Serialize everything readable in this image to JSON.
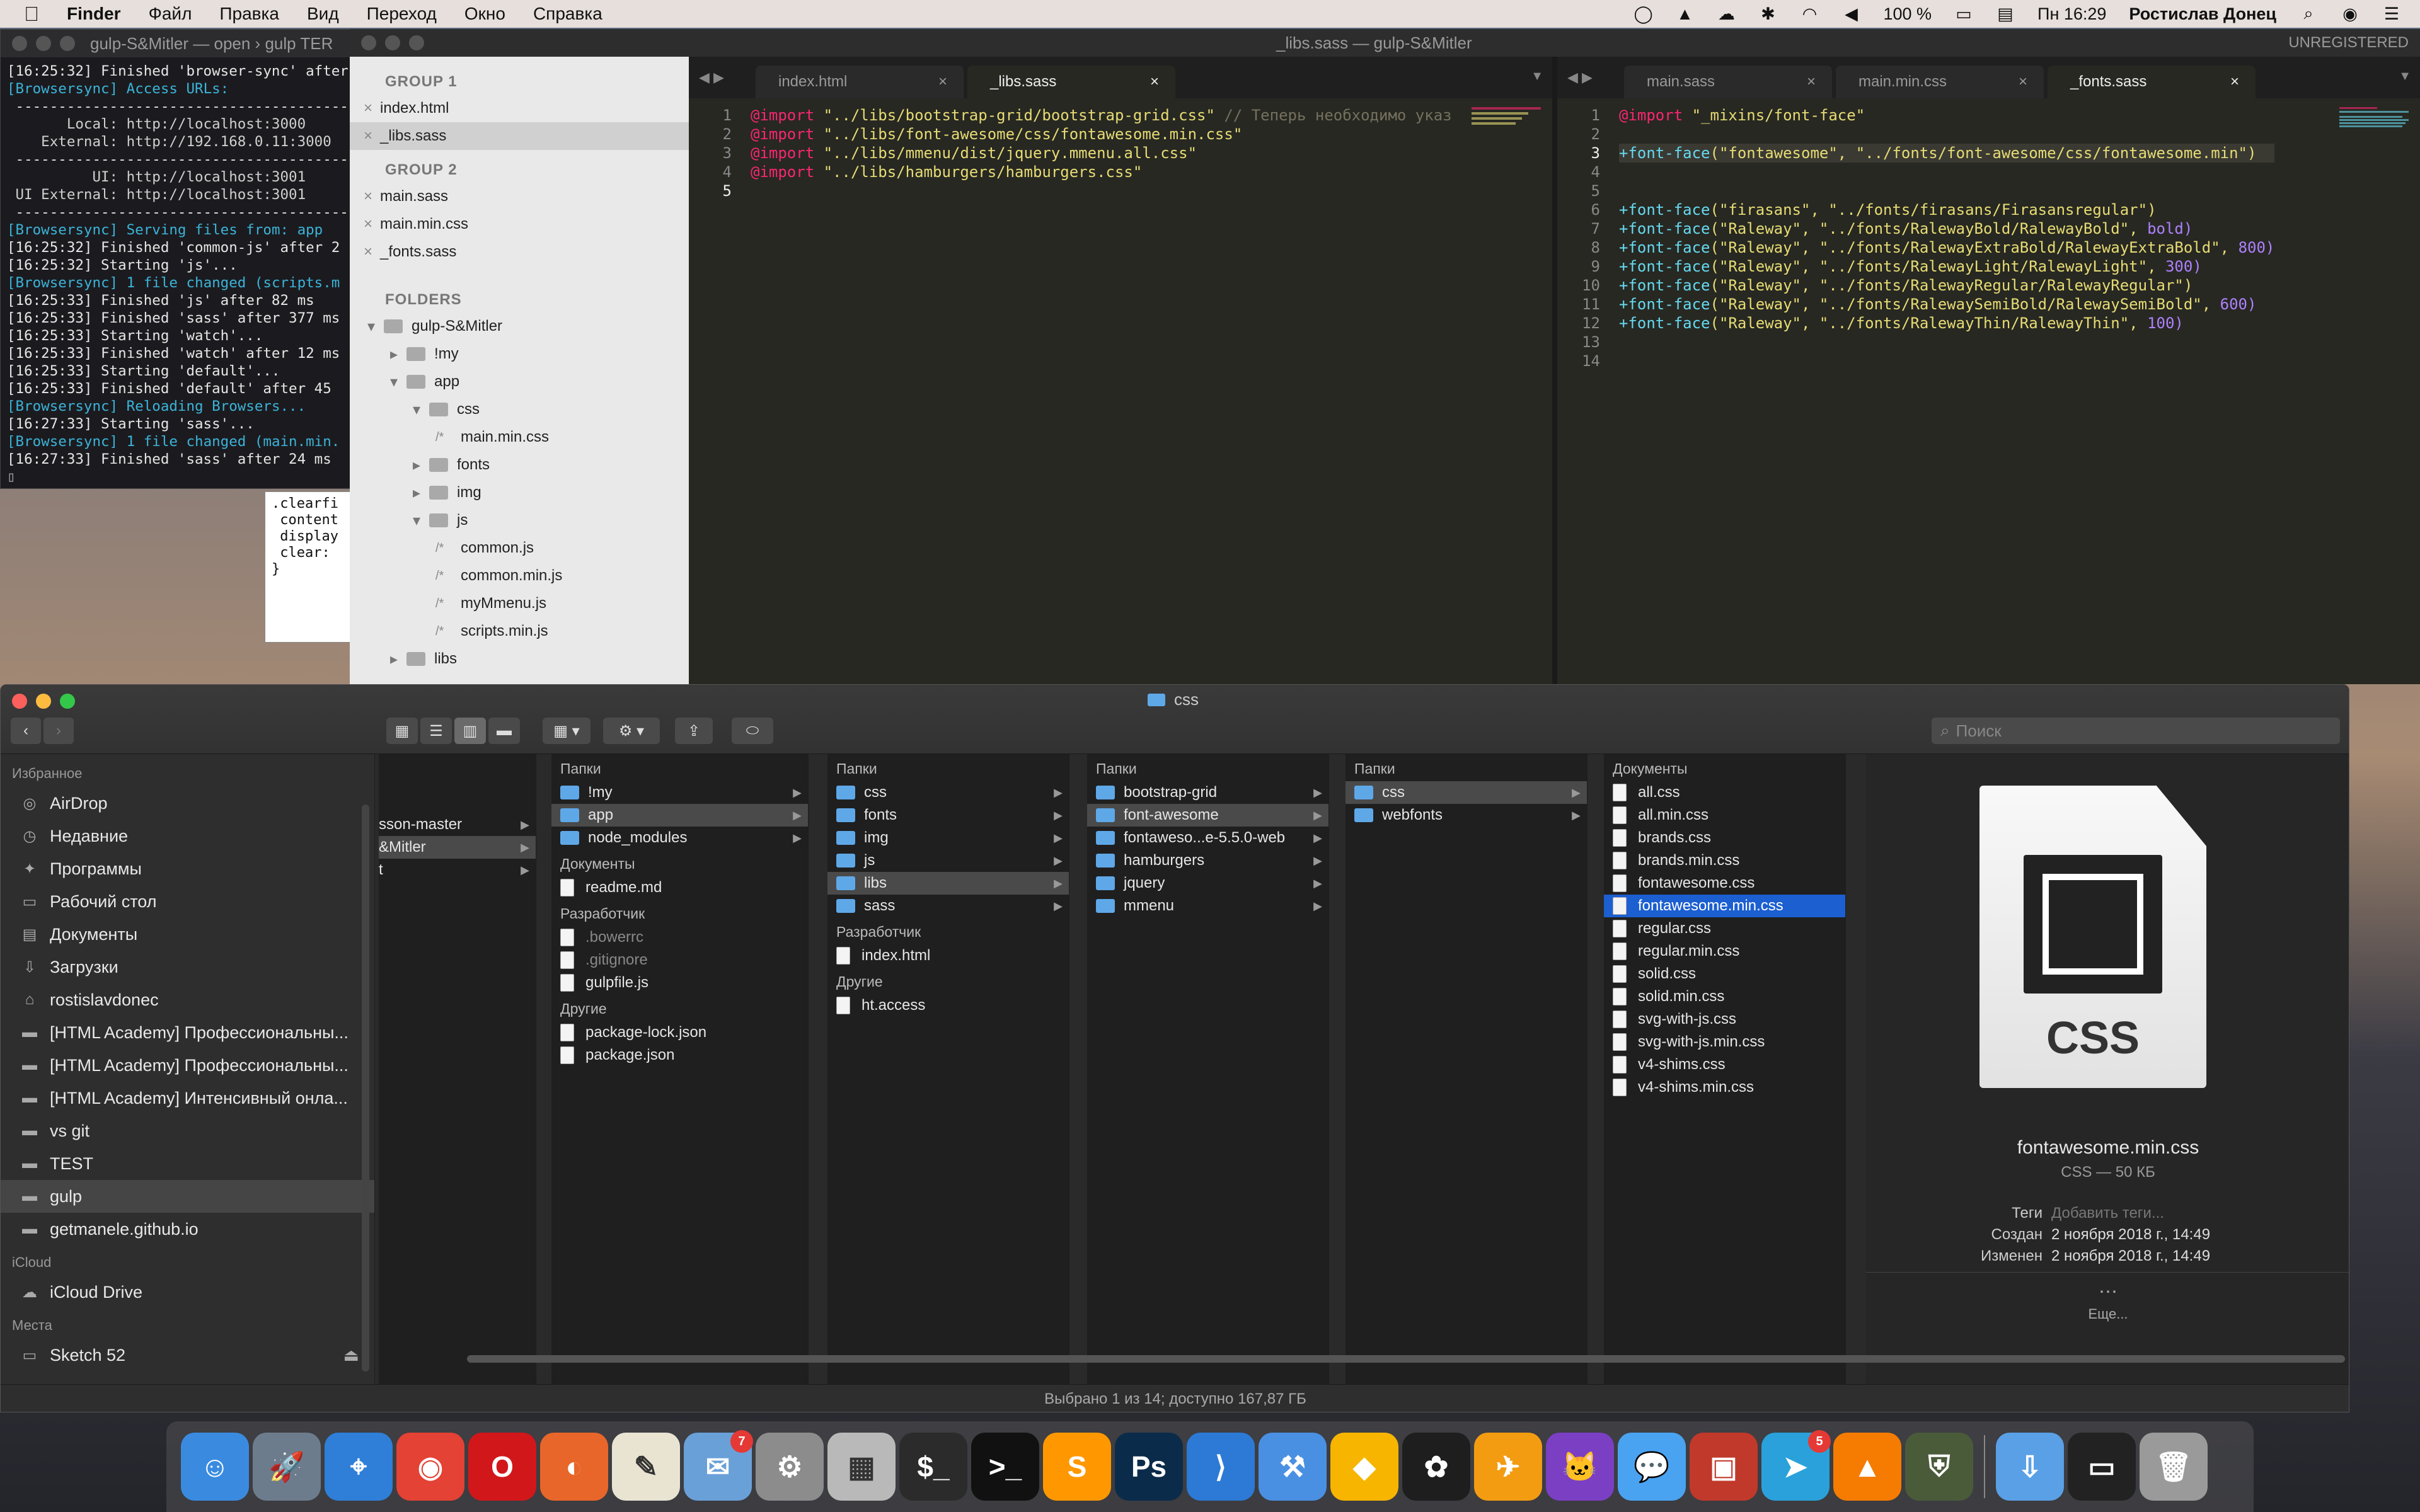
{
  "menubar": {
    "apple_icon": "apple-icon",
    "app_name": "Finder",
    "items": [
      "Файл",
      "Правка",
      "Вид",
      "Переход",
      "Окно",
      "Справка"
    ],
    "battery": "100 %",
    "clock": "Пн 16:29",
    "user": "Ростислав Донец"
  },
  "terminal": {
    "title": "gulp-S&Mitler — open › gulp TER",
    "lines": [
      "[16:25:32] Finished 'browser-sync' after",
      "[Browsersync] Access URLs:",
      " ----------------------------------------",
      "       Local: http://localhost:3000",
      "    External: http://192.168.0.11:3000",
      " ----------------------------------------",
      "          UI: http://localhost:3001",
      " UI External: http://localhost:3001",
      " ----------------------------------------",
      "[Browsersync] Serving files from: app",
      "[16:25:32] Finished 'common-js' after 2",
      "[16:25:32] Starting 'js'...",
      "[Browsersync] 1 file changed (scripts.m",
      "[16:25:33] Finished 'js' after 82 ms",
      "[16:25:33] Finished 'sass' after 377 ms",
      "[16:25:33] Starting 'watch'...",
      "[16:25:33] Finished 'watch' after 12 ms",
      "[16:25:33] Starting 'default'...",
      "[16:25:33] Finished 'default' after 45",
      "[Browsersync] Reloading Browsers...",
      "[16:27:33] Starting 'sass'...",
      "[Browsersync] 1 file changed (main.min.",
      "[16:27:33] Finished 'sass' after 24 ms"
    ]
  },
  "snippet": {
    "lines": [
      ".clearfi",
      " content",
      " display",
      " clear:",
      "}"
    ]
  },
  "sublime": {
    "title": "_libs.sass — gulp-S&Mitler",
    "unregistered": "UNREGISTERED",
    "sidebar": {
      "group1_label": "GROUP 1",
      "group1_files": [
        "index.html",
        "_libs.sass"
      ],
      "group2_label": "GROUP 2",
      "group2_files": [
        "main.sass",
        "main.min.css",
        "_fonts.sass"
      ],
      "folders_label": "FOLDERS",
      "tree": [
        {
          "label": "gulp-S&Mitler",
          "kind": "folder",
          "open": true
        },
        {
          "label": "!my",
          "kind": "folder",
          "open": false
        },
        {
          "label": "app",
          "kind": "folder",
          "open": true
        },
        {
          "label": "css",
          "kind": "folder",
          "open": true
        },
        {
          "label": "main.min.css",
          "kind": "file"
        },
        {
          "label": "fonts",
          "kind": "folder",
          "open": false
        },
        {
          "label": "img",
          "kind": "folder",
          "open": false
        },
        {
          "label": "js",
          "kind": "folder",
          "open": true
        },
        {
          "label": "common.js",
          "kind": "file"
        },
        {
          "label": "common.min.js",
          "kind": "file"
        },
        {
          "label": "myMmenu.js",
          "kind": "file"
        },
        {
          "label": "scripts.min.js",
          "kind": "file"
        },
        {
          "label": "libs",
          "kind": "folder",
          "open": false
        }
      ]
    },
    "left_pane": {
      "tabs": [
        "index.html",
        "_libs.sass"
      ],
      "active_tab": 1,
      "line_numbers": [
        "1",
        "2",
        "3",
        "4",
        "5"
      ],
      "code": [
        {
          "kw": "@import",
          "str": " \"../libs/bootstrap-grid/bootstrap-grid.css\"",
          "cmt": " // Теперь необходимо указ"
        },
        {
          "kw": "@import",
          "str": " \"../libs/font-awesome/css/fontawesome.min.css\"",
          "cmt": ""
        },
        {
          "kw": "@import",
          "str": " \"../libs/mmenu/dist/jquery.mmenu.all.css\"",
          "cmt": ""
        },
        {
          "kw": "@import",
          "str": " \"../libs/hamburgers/hamburgers.css\"",
          "cmt": ""
        },
        {
          "kw": "",
          "str": "",
          "cmt": ""
        }
      ]
    },
    "right_pane": {
      "tabs": [
        "main.sass",
        "main.min.css",
        "_fonts.sass"
      ],
      "active_tab": 2,
      "line_numbers": [
        "1",
        "2",
        "3",
        "4",
        "5",
        "6",
        "7",
        "8",
        "9",
        "10",
        "11",
        "12",
        "13",
        "14"
      ],
      "code": [
        {
          "a": "@import",
          "b": " \"_mixins/font-face\"",
          "c": ""
        },
        {
          "a": "",
          "b": "",
          "c": ""
        },
        {
          "a": "+font-face",
          "b": "(\"fontawesome\", \"../fonts/font-awesome/css/fontawesome.min\")",
          "c": ""
        },
        {
          "a": "",
          "b": "",
          "c": ""
        },
        {
          "a": "",
          "b": "",
          "c": ""
        },
        {
          "a": "+font-face",
          "b": "(\"firasans\", \"../fonts/firasans/Firasansregular\")",
          "c": ""
        },
        {
          "a": "+font-face",
          "b": "(\"Raleway\", \"../fonts/RalewayBold/RalewayBold\", ",
          "c": "bold)"
        },
        {
          "a": "+font-face",
          "b": "(\"Raleway\", \"../fonts/RalewayExtraBold/RalewayExtraBold\", ",
          "c": "800)"
        },
        {
          "a": "+font-face",
          "b": "(\"Raleway\", \"../fonts/RalewayLight/RalewayLight\", ",
          "c": "300)"
        },
        {
          "a": "+font-face",
          "b": "(\"Raleway\", \"../fonts/RalewayRegular/RalewayRegular\")",
          "c": ""
        },
        {
          "a": "+font-face",
          "b": "(\"Raleway\", \"../fonts/RalewaySemiBold/RalewaySemiBold\", ",
          "c": "600)"
        },
        {
          "a": "+font-face",
          "b": "(\"Raleway\", \"../fonts/RalewayThin/RalewayThin\", ",
          "c": "100)"
        },
        {
          "a": "",
          "b": "",
          "c": ""
        },
        {
          "a": "",
          "b": "",
          "c": ""
        }
      ]
    }
  },
  "finder": {
    "title": "css",
    "search_placeholder": "Поиск",
    "sidebar": {
      "favorites_label": "Избранное",
      "favorites": [
        {
          "label": "AirDrop",
          "icon": "airdrop-icon"
        },
        {
          "label": "Недавние",
          "icon": "recents-icon"
        },
        {
          "label": "Программы",
          "icon": "applications-icon"
        },
        {
          "label": "Рабочий стол",
          "icon": "desktop-icon"
        },
        {
          "label": "Документы",
          "icon": "documents-icon"
        },
        {
          "label": "Загрузки",
          "icon": "downloads-icon"
        },
        {
          "label": "rostislavdonec",
          "icon": "home-icon"
        },
        {
          "label": "[HTML Academy] Профессиональны...",
          "icon": "folder-icon"
        },
        {
          "label": "[HTML Academy] Профессиональны...",
          "icon": "folder-icon"
        },
        {
          "label": "[HTML Academy] Интенсивный онла...",
          "icon": "folder-icon"
        },
        {
          "label": "vs git",
          "icon": "folder-icon"
        },
        {
          "label": "TEST",
          "icon": "folder-icon"
        },
        {
          "label": "gulp",
          "icon": "folder-icon"
        },
        {
          "label": "getmanele.github.io",
          "icon": "folder-icon"
        }
      ],
      "icloud_label": "iCloud",
      "icloud": [
        {
          "label": "iCloud Drive",
          "icon": "cloud-icon"
        }
      ],
      "places_label": "Места",
      "places": [
        {
          "label": "Sketch 52",
          "icon": "disk-icon"
        }
      ]
    },
    "col0": [
      "sson-master",
      "&Mitler",
      "t"
    ],
    "col1": {
      "folders_label": "Папки",
      "folders": [
        "!my",
        "app",
        "node_modules"
      ],
      "docs_label": "Документы",
      "docs": [
        "readme.md"
      ],
      "dev_label": "Разработчик",
      "dev": [
        ".bowerrc",
        ".gitignore",
        "gulpfile.js"
      ],
      "other_label": "Другие",
      "other": [
        "package-lock.json",
        "package.json"
      ]
    },
    "col2": {
      "folders_label": "Папки",
      "folders": [
        "css",
        "fonts",
        "img",
        "js",
        "libs",
        "sass"
      ],
      "dev_label": "Разработчик",
      "dev": [
        "index.html"
      ],
      "other_label": "Другие",
      "other": [
        "ht.access"
      ]
    },
    "col3": {
      "folders_label": "Папки",
      "folders": [
        "bootstrap-grid",
        "font-awesome",
        "fontaweso...e-5.5.0-web",
        "hamburgers",
        "jquery",
        "mmenu"
      ]
    },
    "col4": {
      "folders_label": "Папки",
      "folders": [
        "css",
        "webfonts"
      ]
    },
    "col5": {
      "docs_label": "Документы",
      "docs": [
        "all.css",
        "all.min.css",
        "brands.css",
        "brands.min.css",
        "fontawesome.css",
        "fontawesome.min.css",
        "regular.css",
        "regular.min.css",
        "solid.css",
        "solid.min.css",
        "svg-with-js.css",
        "svg-with-js.min.css",
        "v4-shims.css",
        "v4-shims.min.css"
      ]
    },
    "preview": {
      "badge_text": "CSS",
      "filename": "fontawesome.min.css",
      "kind_size": "CSS — 50 КБ",
      "tags_label": "Теги",
      "tags_placeholder": "Добавить теги...",
      "created_label": "Создан",
      "created": "2 ноября 2018 г., 14:49",
      "modified_label": "Изменен",
      "modified": "2 ноября 2018 г., 14:49",
      "more_label": "Еще..."
    },
    "status": "Выбрано 1 из 14; доступно 167,87 ГБ"
  },
  "dock": {
    "apps": [
      {
        "name": "finder",
        "color": "#3a8be0",
        "glyph": "☺"
      },
      {
        "name": "launchpad",
        "color": "#6d7c8c",
        "glyph": "🚀"
      },
      {
        "name": "safari",
        "color": "#2f7fd8",
        "glyph": "⌖"
      },
      {
        "name": "chrome",
        "color": "#e34234",
        "glyph": "◉"
      },
      {
        "name": "opera",
        "color": "#d2171b",
        "glyph": "O"
      },
      {
        "name": "firefox",
        "color": "#e8662a",
        "glyph": "◐"
      },
      {
        "name": "notes",
        "color": "#e9e4d2",
        "glyph": "✎"
      },
      {
        "name": "mail-stamp",
        "color": "#6aa0d8",
        "glyph": "✉",
        "badge": "7"
      },
      {
        "name": "system-preferences",
        "color": "#8c8c8c",
        "glyph": "⚙"
      },
      {
        "name": "calculator",
        "color": "#b9b9b9",
        "glyph": "▦"
      },
      {
        "name": "iterm",
        "color": "#2b2b2b",
        "glyph": "$_"
      },
      {
        "name": "terminal",
        "color": "#111111",
        "glyph": ">_"
      },
      {
        "name": "sublime-text",
        "color": "#ff9800",
        "glyph": "S"
      },
      {
        "name": "photoshop",
        "color": "#0b2b4a",
        "glyph": "Ps"
      },
      {
        "name": "vscode",
        "color": "#2c7ad6",
        "glyph": "⟩"
      },
      {
        "name": "xcode",
        "color": "#4a90e2",
        "glyph": "⚒"
      },
      {
        "name": "sketch",
        "color": "#f7b500",
        "glyph": "◆"
      },
      {
        "name": "figma",
        "color": "#1e1e1e",
        "glyph": "✿"
      },
      {
        "name": "transmit",
        "color": "#f39c12",
        "glyph": "✈"
      },
      {
        "name": "github-desktop",
        "color": "#7b3fc4",
        "glyph": "🐱"
      },
      {
        "name": "messages",
        "color": "#4aa3f0",
        "glyph": "💬"
      },
      {
        "name": "photo-booth",
        "color": "#c0392b",
        "glyph": "▣"
      },
      {
        "name": "telegram",
        "color": "#2aa1da",
        "glyph": "➤",
        "badge": "5"
      },
      {
        "name": "vlc",
        "color": "#f57c00",
        "glyph": "▲"
      },
      {
        "name": "world-of-tanks",
        "color": "#4a5b3a",
        "glyph": "⛨"
      },
      {
        "name": "downloads-stack",
        "color": "#5aa0e6",
        "glyph": "⇩"
      },
      {
        "name": "terminal-stack",
        "color": "#222222",
        "glyph": "▭"
      },
      {
        "name": "trash",
        "color": "#9a9a9a",
        "glyph": "🗑"
      }
    ]
  }
}
